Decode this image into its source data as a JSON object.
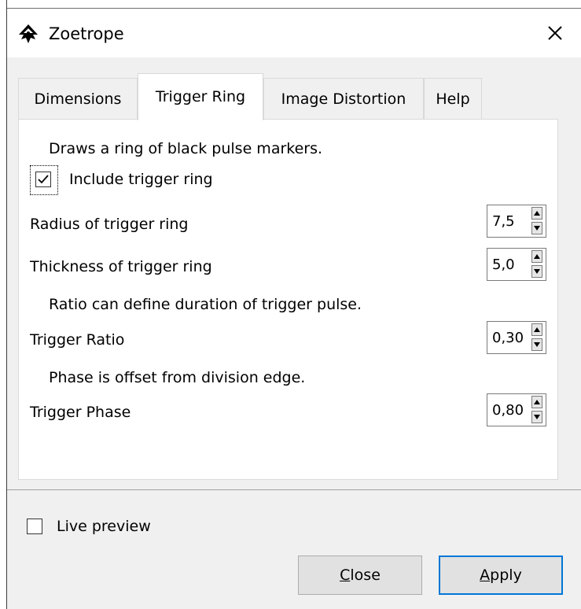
{
  "window": {
    "title": "Zoetrope",
    "icon": "inkscape-logo-icon",
    "close_icon": "close-icon"
  },
  "tabs": [
    {
      "label": "Dimensions",
      "active": false
    },
    {
      "label": "Trigger Ring",
      "active": true
    },
    {
      "label": "Image Distortion",
      "active": false
    },
    {
      "label": "Help",
      "active": false
    }
  ],
  "panel": {
    "intro": "Draws a ring of black pulse markers.",
    "include_trigger_ring": {
      "label": "Include trigger ring",
      "checked": true
    },
    "radius": {
      "label": "Radius of trigger ring",
      "value": "7,5"
    },
    "thickness": {
      "label": "Thickness of trigger ring",
      "value": "5,0"
    },
    "ratio_note": "Ratio can define duration of trigger pulse.",
    "ratio": {
      "label": "Trigger Ratio",
      "value": "0,30"
    },
    "phase_note": "Phase is offset from division edge.",
    "phase": {
      "label": "Trigger Phase",
      "value": "0,80"
    }
  },
  "footer": {
    "live_preview": {
      "label": "Live preview",
      "checked": false
    },
    "close_button": {
      "mnemonic": "C",
      "rest": "lose"
    },
    "apply_button": {
      "mnemonic": "A",
      "rest": "pply"
    }
  },
  "colors": {
    "accent": "#0078d7",
    "window_bg": "#f0f0f0",
    "panel_bg": "#ffffff"
  }
}
